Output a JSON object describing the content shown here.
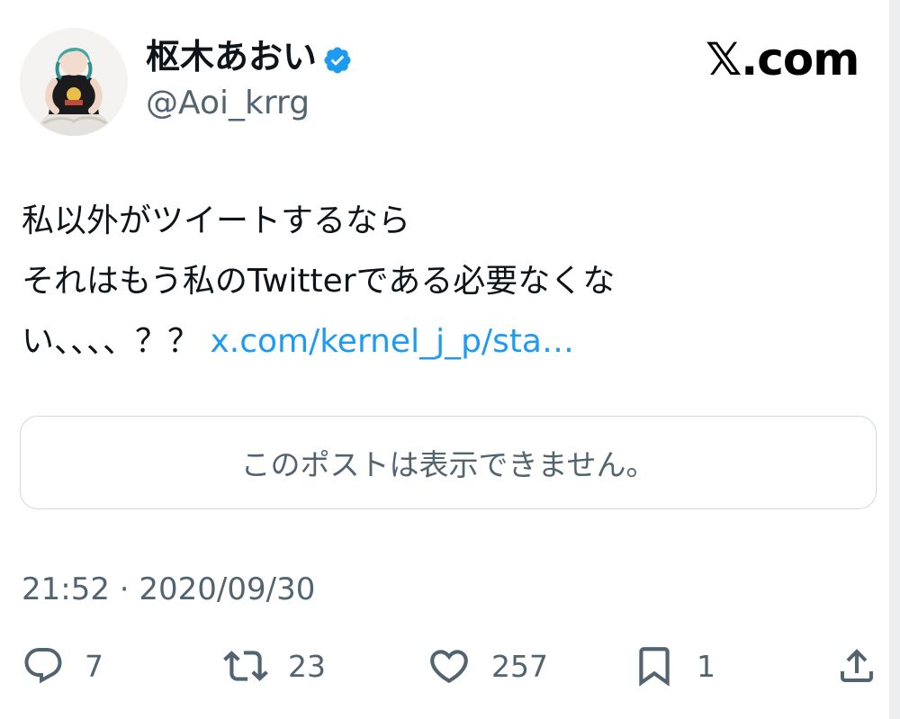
{
  "author": {
    "display_name": "枢木あおい",
    "handle": "@Aoi_krrg",
    "verified_icon": "verified-badge-icon",
    "accent_color": "#1d9bf0"
  },
  "brand": {
    "label": "𝕏.com"
  },
  "tweet": {
    "line1": "私以外がツイートするなら",
    "line2": "それはもう私のTwitterである必要なくな",
    "line3": "い、、、、？？",
    "link_text": "x.com/kernel_j_p/sta…"
  },
  "quote": {
    "message": "このポストは表示できません。"
  },
  "meta": {
    "timestamp": "21:52 · 2020/09/30"
  },
  "actions": {
    "reply": {
      "icon": "reply-icon",
      "count": "7"
    },
    "repost": {
      "icon": "repost-icon",
      "count": "23"
    },
    "like": {
      "icon": "heart-icon",
      "count": "257"
    },
    "bookmark": {
      "icon": "bookmark-icon",
      "count": "1"
    },
    "share": {
      "icon": "share-icon"
    }
  }
}
